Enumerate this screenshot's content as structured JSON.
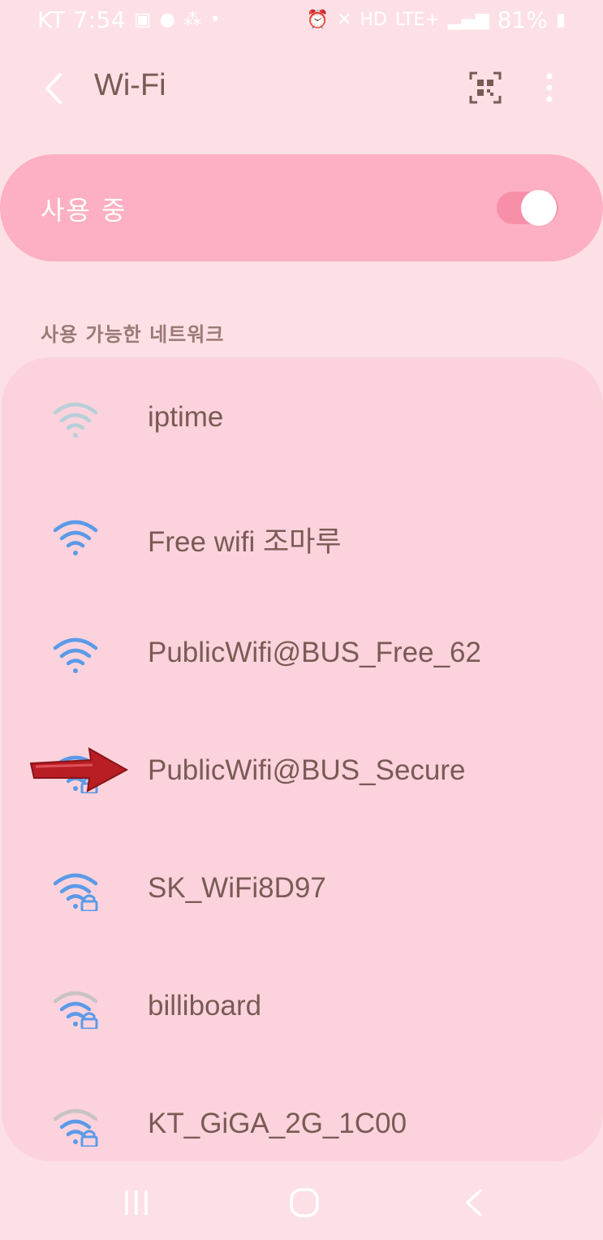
{
  "status_bar": {
    "carrier": "KT",
    "time": "7:54",
    "network_type": "LTE+",
    "battery": "81%"
  },
  "header": {
    "title": "Wi-Fi",
    "back_icon": "chevron-left-icon",
    "qr_icon": "qr-code-scan-icon",
    "more_icon": "more-vertical-icon"
  },
  "wifi_toggle": {
    "label": "사용 중",
    "state": "on",
    "accent_color": "#f78fa8"
  },
  "section": {
    "title": "사용 가능한 네트워크"
  },
  "networks": [
    {
      "name": "iptime",
      "signal": "faint",
      "secured": false
    },
    {
      "name": "Free wifi 조마루",
      "signal": "full",
      "secured": false
    },
    {
      "name": "PublicWifi@BUS_Free_62",
      "signal": "full",
      "secured": false
    },
    {
      "name": "PublicWifi@BUS_Secure",
      "signal": "full",
      "secured": true
    },
    {
      "name": "SK_WiFi8D97",
      "signal": "full",
      "secured": true
    },
    {
      "name": "billiboard",
      "signal": "partial",
      "secured": true
    },
    {
      "name": "KT_GiGA_2G_1C00",
      "signal": "partial",
      "secured": true
    }
  ],
  "annotation": {
    "arrow_color": "#b81e24",
    "points_to": "PublicWifi@BUS_Secure"
  },
  "nav_bar": {
    "recents_icon": "recents-icon",
    "home_icon": "home-icon",
    "back_icon": "back-icon"
  }
}
